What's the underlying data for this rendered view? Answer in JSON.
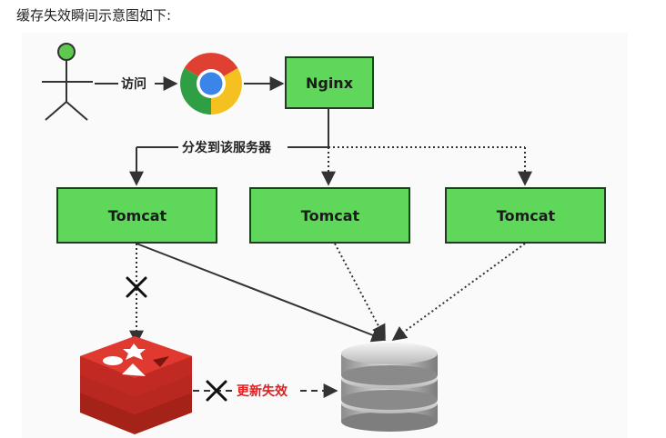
{
  "caption": "缓存失效瞬间示意图如下:",
  "nodes": {
    "nginx": "Nginx",
    "tomcat_left": "Tomcat",
    "tomcat_center": "Tomcat",
    "tomcat_right": "Tomcat"
  },
  "edge_labels": {
    "visit": "访问",
    "distribute": "分发到该服务器",
    "update_failed": "更新失效"
  },
  "colors": {
    "box_fill": "#5fd75a",
    "box_stroke": "#1f3d1f",
    "person": "#5dc94f",
    "redis_red": "#d9322a",
    "update_failed_text": "#e02020",
    "edge": "#333333"
  },
  "icons": [
    "user-actor-icon",
    "chrome-browser-icon",
    "redis-icon",
    "database-icon",
    "cross-icon"
  ]
}
